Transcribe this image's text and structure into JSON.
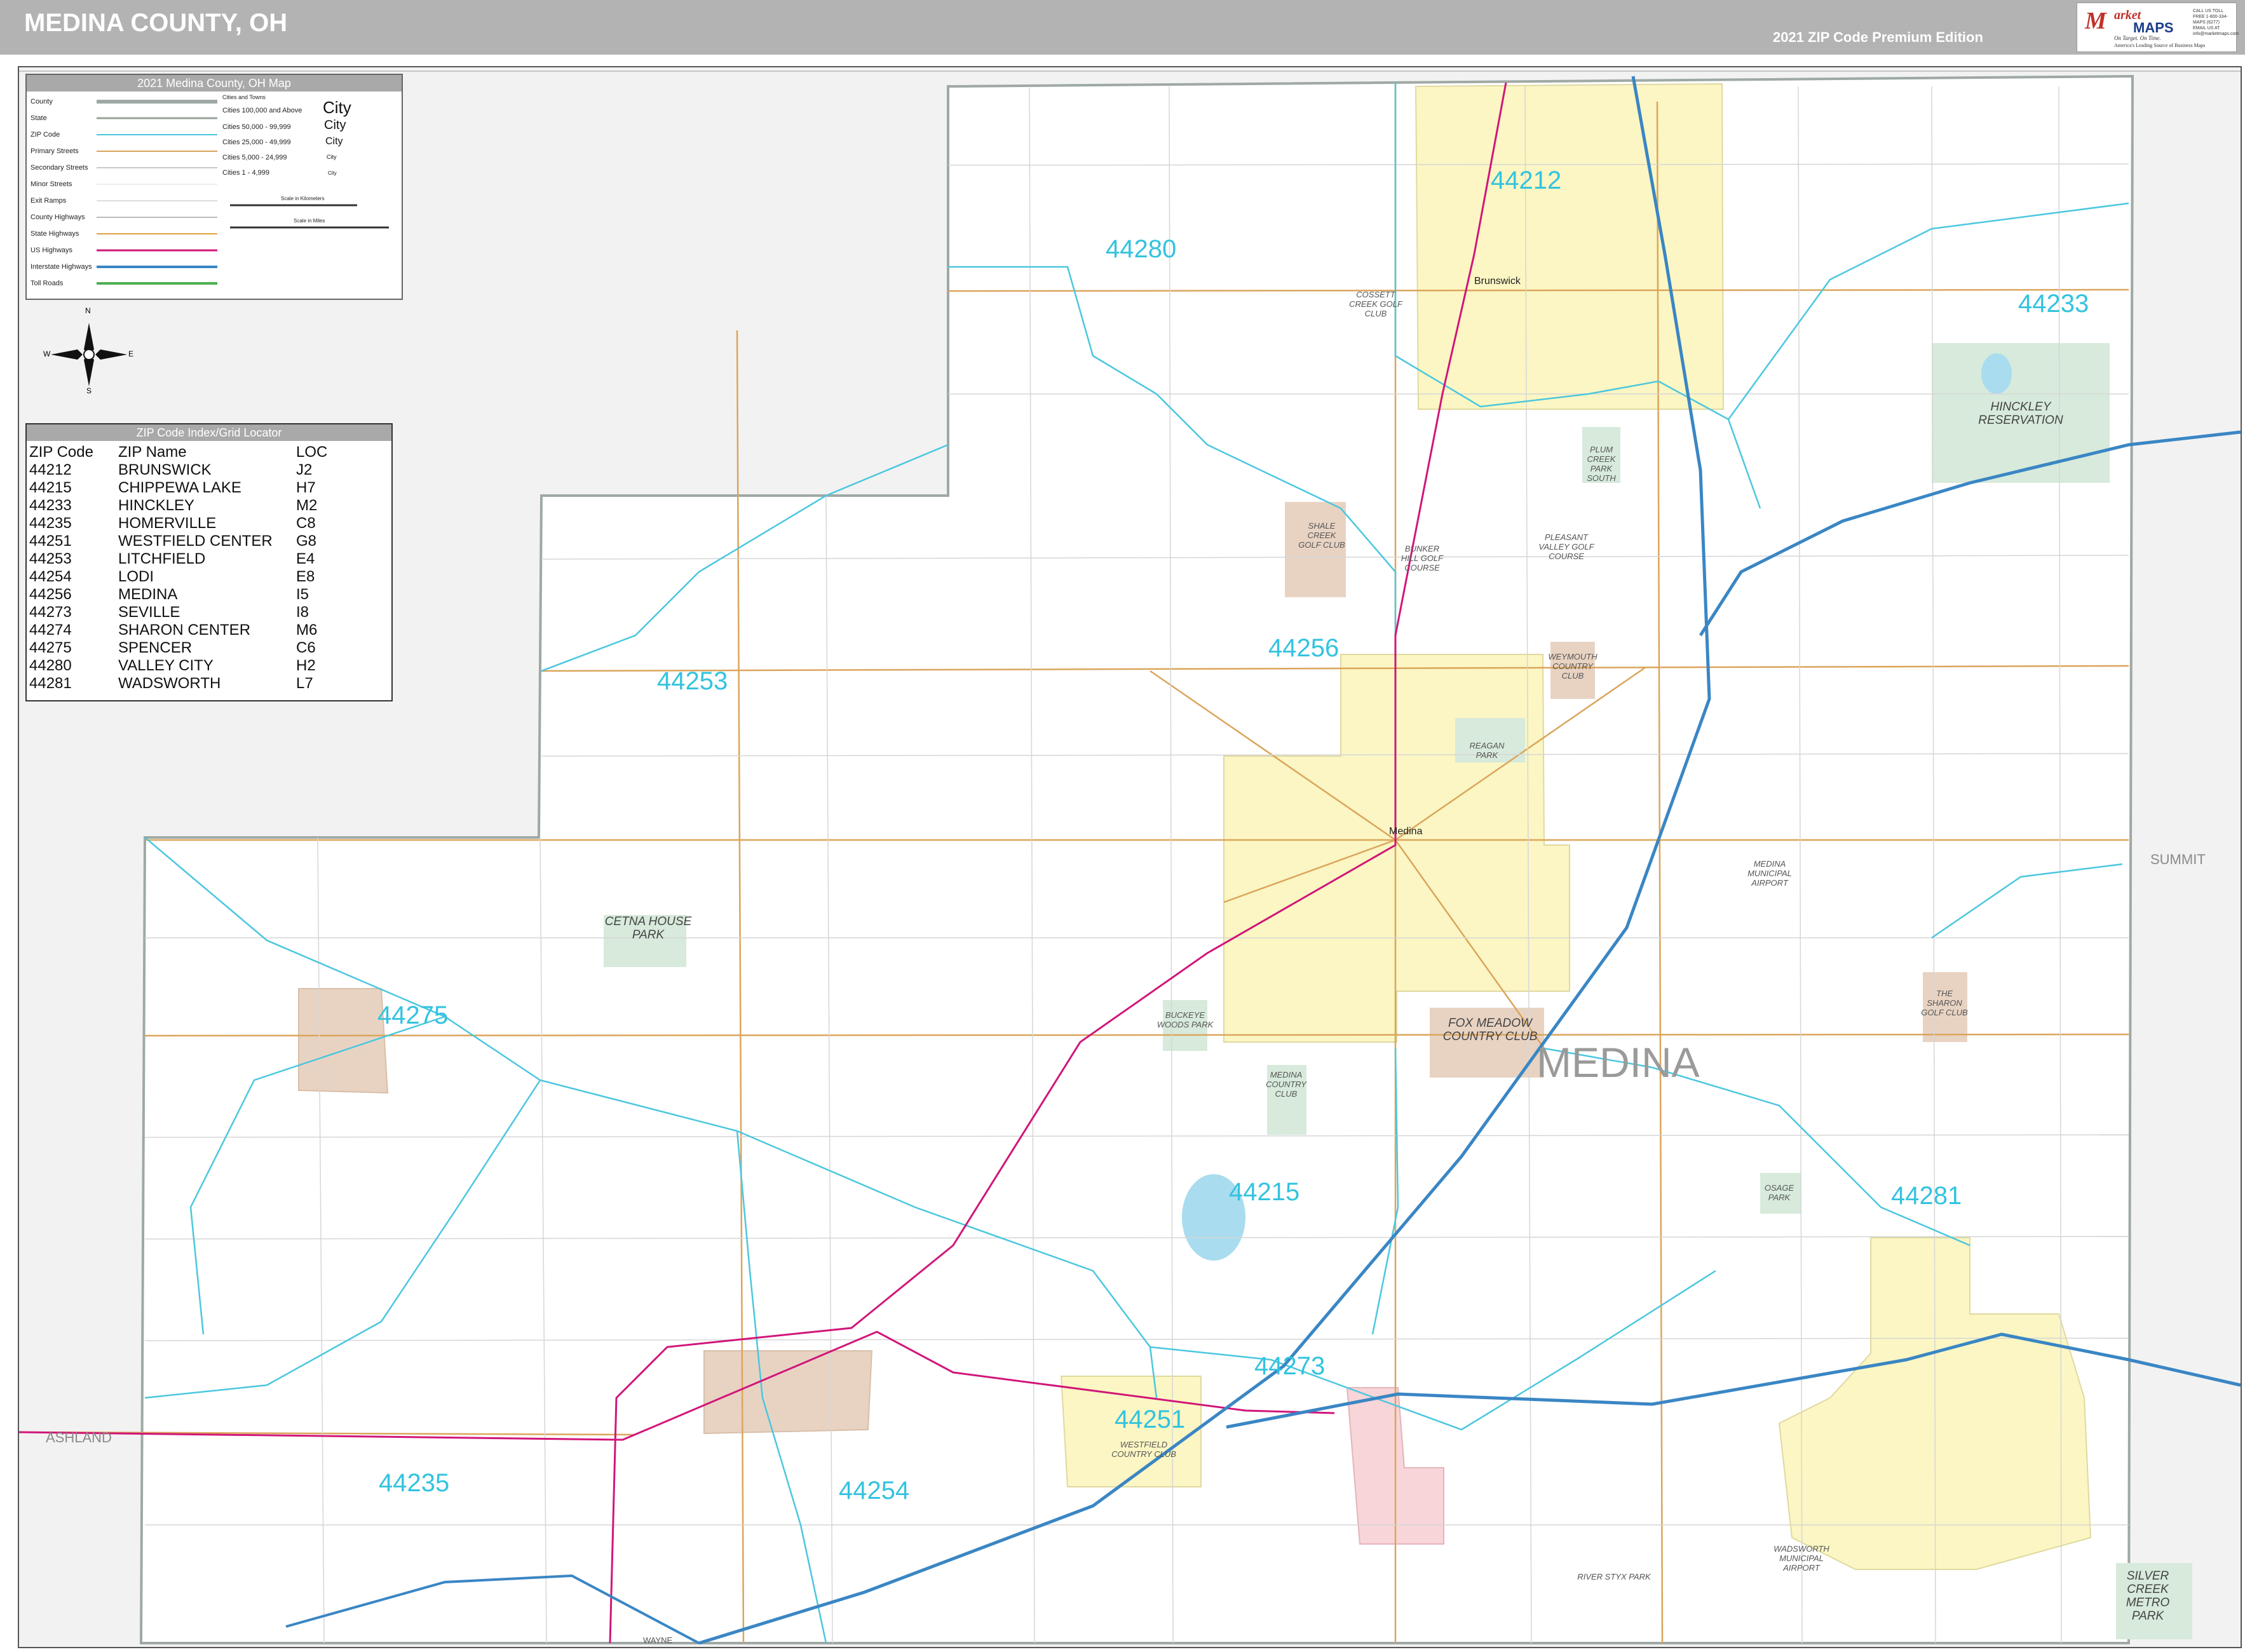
{
  "header": {
    "title": "MEDINA COUNTY, OH",
    "edition": "2021 ZIP Code Premium Edition",
    "logo_mark": "M",
    "logo_word1": "arket",
    "logo_word2": "MAPS",
    "logo_tagline": "On Target.  On Time.",
    "logo_tagline2": "America's Leading Source of Business Maps",
    "logo_contact": "CALL US TOLL FREE 1-800-334-MAPS (6277) EMAIL US AT info@marketmaps.com"
  },
  "legend": {
    "title": "2021 Medina County, OH Map",
    "items": [
      "County",
      "State",
      "ZIP Code",
      "Primary Streets",
      "Secondary Streets",
      "Minor Streets",
      "Exit Ramps",
      "County Highways",
      "State Highways",
      "US Highways",
      "Interstate Highways",
      "Toll Roads"
    ],
    "line_colors": [
      "#9ea9a3",
      "#9aa39a",
      "#4bc7df",
      "#d8a35a",
      "#c8c8c8",
      "#dddddd",
      "#bbbbbb",
      "#bbbbbb",
      "#e0a040",
      "#d1167a",
      "#3a86c4",
      "#4caf50"
    ],
    "cities_header": "Cities and Towns",
    "city_classes": [
      "Cities 100,000 and Above",
      "Cities 50,000 - 99,999",
      "Cities 25,000 - 49,999",
      "Cities 5,000 - 24,999",
      "Cities 1 - 4,999"
    ],
    "city_samples": [
      "City",
      "City",
      "City",
      "City",
      "City"
    ],
    "scale_km": "Scale in Kilometers",
    "scale_mi": "Scale in Miles"
  },
  "compass": {
    "n": "N",
    "s": "S",
    "e": "E",
    "w": "W"
  },
  "zip_index": {
    "title": "ZIP Code Index/Grid Locator",
    "headers": [
      "ZIP Code",
      "ZIP Name",
      "LOC"
    ],
    "rows": [
      [
        "44212",
        "BRUNSWICK",
        "J2"
      ],
      [
        "44215",
        "CHIPPEWA LAKE",
        "H7"
      ],
      [
        "44233",
        "HINCKLEY",
        "M2"
      ],
      [
        "44235",
        "HOMERVILLE",
        "C8"
      ],
      [
        "44251",
        "WESTFIELD CENTER",
        "G8"
      ],
      [
        "44253",
        "LITCHFIELD",
        "E4"
      ],
      [
        "44254",
        "LODI",
        "E8"
      ],
      [
        "44256",
        "MEDINA",
        "I5"
      ],
      [
        "44273",
        "SEVILLE",
        "I8"
      ],
      [
        "44274",
        "SHARON CENTER",
        "M6"
      ],
      [
        "44275",
        "SPENCER",
        "C6"
      ],
      [
        "44280",
        "VALLEY CITY",
        "H2"
      ],
      [
        "44281",
        "WADSWORTH",
        "L7"
      ]
    ]
  },
  "zip_labels": [
    "44212",
    "44280",
    "44233",
    "44256",
    "44253",
    "44275",
    "44215",
    "44281",
    "44273",
    "44251",
    "44235",
    "44254"
  ],
  "county_labels": {
    "main": "MEDINA",
    "east": "SUMMIT",
    "west": "ASHLAND",
    "south": "WAYNE"
  },
  "cities": {
    "brunswick": "Brunswick",
    "medina": "Medina"
  },
  "parks": [
    "CETNA HOUSE PARK",
    "SHALE CREEK GOLF CLUB",
    "HINCKLEY RESERVATION",
    "FOX MEADOW COUNTRY CLUB",
    "SILVER CREEK METRO PARK",
    "PLUM CREEK PARK SOUTH",
    "BUNKER HILL GOLF COURSE",
    "PLEASANT VALLEY GOLF COURSE",
    "WEYMOUTH COUNTRY CLUB",
    "MEDINA COUNTRY CLUB",
    "WESTFIELD COUNTRY CLUB",
    "BUCKEYE WOODS PARK",
    "REAGAN PARK",
    "MEDINA MUNICIPAL AIRPORT",
    "THE SHARON GOLF CLUB",
    "WADSWORTH MUNICIPAL AIRPORT",
    "OSAGE PARK",
    "COSSETT CREEK GOLF CLUB",
    "RIVER STYX PARK"
  ],
  "colors": {
    "zip_label": "#33c3df",
    "zip_boundary": "#4bc7df",
    "interstate": "#3a86c4",
    "us_highway": "#d1167a",
    "state_highway": "#d8a35a",
    "city_fill": "#fbf6c3",
    "village_fill": "#e8d3c3",
    "park_fill": "#d7eadb",
    "outside_county": "#f2f2f2"
  }
}
